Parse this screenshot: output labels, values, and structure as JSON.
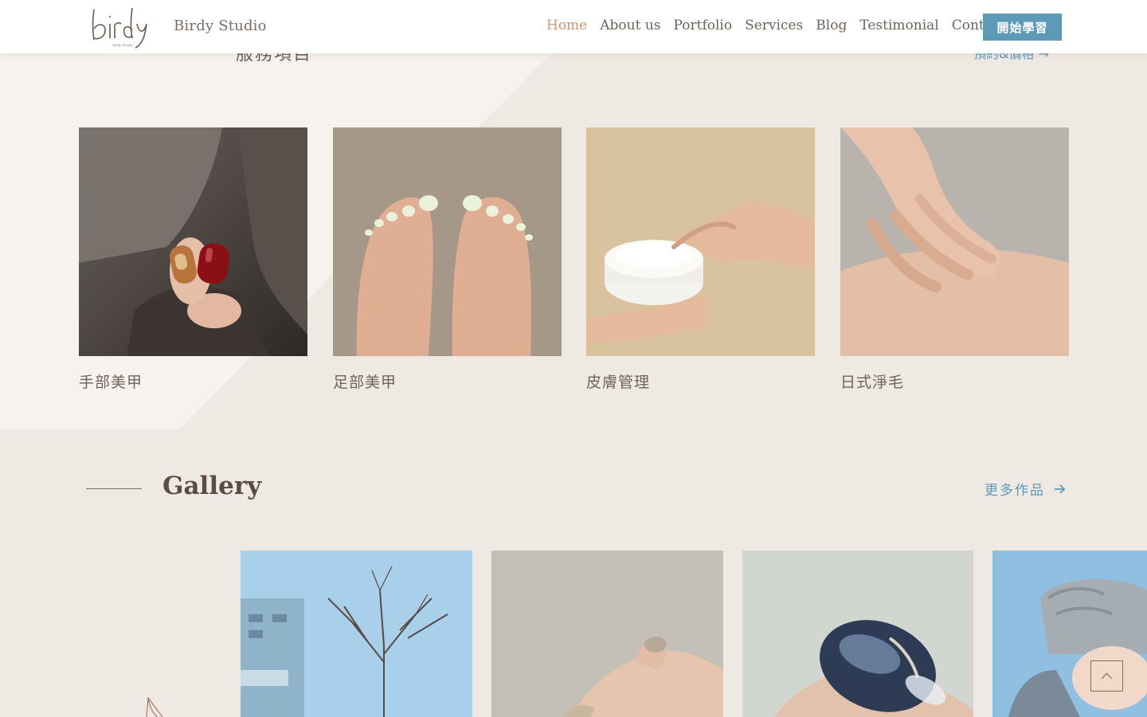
{
  "header": {
    "brand": "Birdy Studio",
    "logo_text": "birdy",
    "logo_subtext": "Birdy Studio",
    "nav": [
      {
        "label": "Home",
        "active": true
      },
      {
        "label": "About us",
        "active": false
      },
      {
        "label": "Portfolio",
        "active": false
      },
      {
        "label": "Services",
        "active": false
      },
      {
        "label": "Blog",
        "active": false
      },
      {
        "label": "Testimonial",
        "active": false
      },
      {
        "label": "Contact",
        "active": false
      }
    ],
    "cta_label": "開始學習"
  },
  "services": {
    "peek_heading": "服務項目",
    "peek_link": "預約&價格 →",
    "cards": [
      {
        "title": "手部美甲",
        "image": "hand-nail-art-photo"
      },
      {
        "title": "足部美甲",
        "image": "foot-pedicure-photo"
      },
      {
        "title": "皮膚管理",
        "image": "skin-cream-photo"
      },
      {
        "title": "日式淨毛",
        "image": "hand-on-shoulder-photo"
      }
    ]
  },
  "gallery": {
    "title": "Gallery",
    "more_label": "更多作品",
    "images": [
      "winter-tree-sky-photo",
      "glitter-nail-photo",
      "blue-marble-nail-photo",
      "knit-hat-portrait-photo"
    ]
  },
  "colors": {
    "accent_blue": "#5c9ab8",
    "nav_active": "#d4956b",
    "background": "#efe9e3",
    "text": "#5b4d44"
  },
  "icons": [
    "arrow-right-icon",
    "scroll-top-icon",
    "leaf-outline-icon"
  ]
}
